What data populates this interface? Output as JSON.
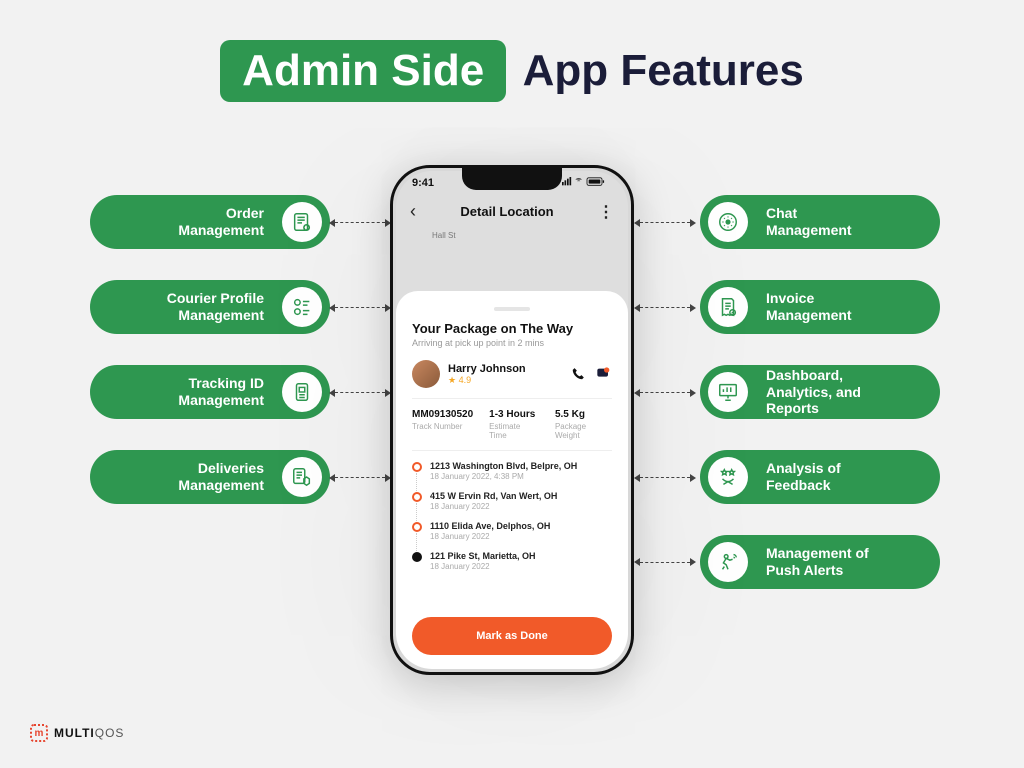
{
  "title": {
    "highlight": "Admin Side",
    "rest": "App Features"
  },
  "left_features": [
    {
      "label": "Order\nManagement",
      "icon": "clipboard-gear"
    },
    {
      "label": "Courier Profile\nManagement",
      "icon": "users-list"
    },
    {
      "label": "Tracking ID\nManagement",
      "icon": "id-card"
    },
    {
      "label": "Deliveries\nManagement",
      "icon": "checklist-box"
    }
  ],
  "right_features": [
    {
      "label": "Chat\nManagement",
      "icon": "chat-gear"
    },
    {
      "label": "Invoice\nManagement",
      "icon": "invoice"
    },
    {
      "label": "Dashboard,\nAnalytics, and\nReports",
      "icon": "presentation-chart"
    },
    {
      "label": "Analysis of\nFeedback",
      "icon": "stars-award"
    },
    {
      "label": "Management of\nPush Alerts",
      "icon": "bell-run"
    }
  ],
  "phone": {
    "status_time": "9:41",
    "screen_title": "Detail Location",
    "street_label": "Hall St",
    "package_heading": "Your Package on The Way",
    "package_sub": "Arriving at pick up point in 2 mins",
    "courier": {
      "name": "Harry Johnson",
      "rating": "4.9"
    },
    "metrics": [
      {
        "value": "MM09130520",
        "label": "Track Number"
      },
      {
        "value": "1-3 Hours",
        "label": "Estimate Time"
      },
      {
        "value": "5.5 Kg",
        "label": "Package Weight"
      }
    ],
    "stops": [
      {
        "addr": "1213 Washington Blvd, Belpre, OH",
        "time": "18 January 2022, 4:38 PM"
      },
      {
        "addr": "415 W Ervin Rd, Van Wert, OH",
        "time": "18 January 2022"
      },
      {
        "addr": "1110 Elida Ave, Delphos, OH",
        "time": "18 January 2022"
      },
      {
        "addr": "121 Pike St, Marietta, OH",
        "time": "18 January 2022"
      }
    ],
    "cta": "Mark as Done"
  },
  "brand": {
    "mark": "m",
    "name_a": "MULTI",
    "name_b": "QOS"
  }
}
